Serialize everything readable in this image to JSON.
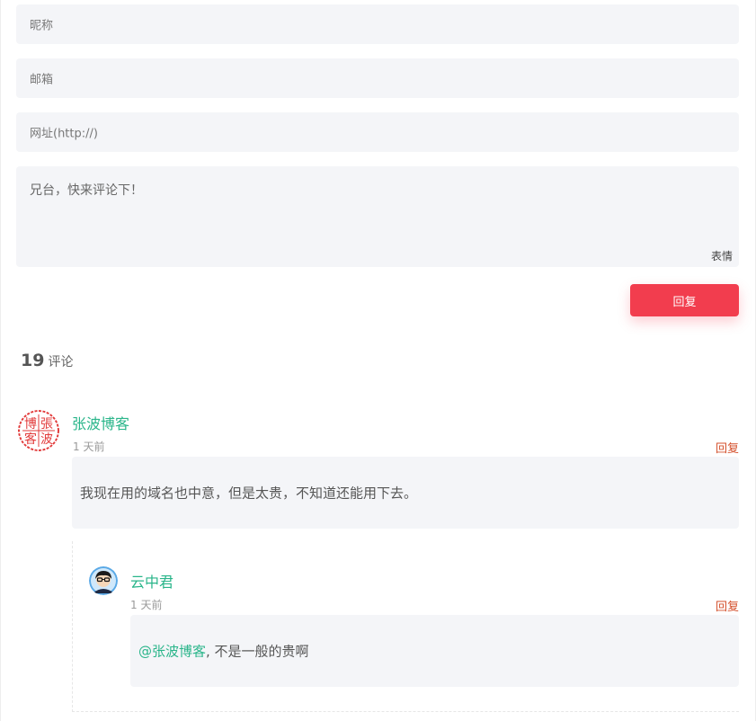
{
  "form": {
    "nick_placeholder": "昵称",
    "email_placeholder": "邮箱",
    "url_placeholder": "网址(http://)",
    "comment_placeholder": "兄台，快来评论下！",
    "emoji_label": "表情",
    "submit_label": "回复"
  },
  "comments_header": {
    "count": "19",
    "label": "评论"
  },
  "comments": [
    {
      "author": "张波博客",
      "time": "1 天前",
      "reply_label": "回复",
      "content": "我现在用的域名也中意，但是太贵，不知道还能用下去。",
      "avatar_text": [
        "張",
        "博",
        "客",
        "波"
      ],
      "children": [
        {
          "author": "云中君",
          "time": "1 天前",
          "reply_label": "回复",
          "mention": "@张波博客",
          "content": ", 不是一般的贵啊"
        }
      ]
    }
  ],
  "colors": {
    "accent_red": "#f23d4e",
    "name_green": "#2ab58a",
    "reply_red": "#d4502c",
    "field_bg": "#f4f5f8"
  }
}
